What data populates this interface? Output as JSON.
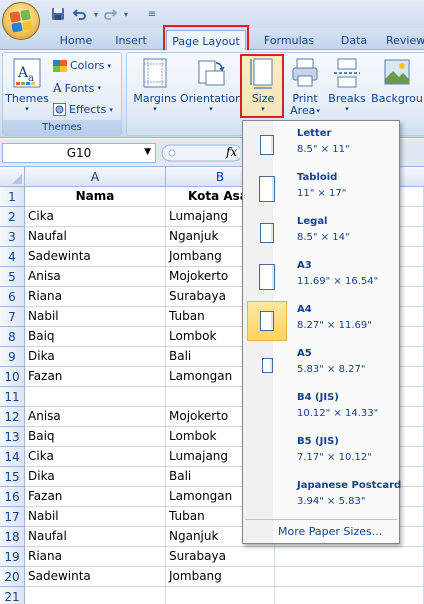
{
  "ribbon_tabs": [
    {
      "label": "Home",
      "active": false
    },
    {
      "label": "Insert",
      "active": false
    },
    {
      "label": "Page Layout",
      "active": true
    },
    {
      "label": "Formulas",
      "active": false
    },
    {
      "label": "Data",
      "active": false
    },
    {
      "label": "Review",
      "active": false
    }
  ],
  "themes_group": {
    "themes_label": "Themes",
    "colors_label": "Colors",
    "fonts_label": "Fonts",
    "effects_label": "Effects",
    "group_label": "Themes"
  },
  "page_setup": {
    "margins_label": "Margins",
    "orientation_label": "Orientation",
    "size_label": "Size",
    "print_area_label_1": "Print",
    "print_area_label_2": "Area",
    "breaks_label": "Breaks",
    "background_label": "Backgrou"
  },
  "formula_bar": {
    "name_box": "G10",
    "fx_symbol": "fx"
  },
  "columns": [
    "A",
    "B"
  ],
  "rows": [
    {
      "n": "1",
      "a": "Nama",
      "b": "Kota Asal",
      "header": true
    },
    {
      "n": "2",
      "a": "Cika",
      "b": "Lumajang"
    },
    {
      "n": "3",
      "a": "Naufal",
      "b": "Nganjuk"
    },
    {
      "n": "4",
      "a": "Sadewinta",
      "b": "Jombang"
    },
    {
      "n": "5",
      "a": "Anisa",
      "b": "Mojokerto"
    },
    {
      "n": "6",
      "a": "Riana",
      "b": "Surabaya"
    },
    {
      "n": "7",
      "a": "Nabil",
      "b": "Tuban"
    },
    {
      "n": "8",
      "a": "Baiq",
      "b": "Lombok"
    },
    {
      "n": "9",
      "a": "Dika",
      "b": "Bali"
    },
    {
      "n": "10",
      "a": "Fazan",
      "b": "Lamongan"
    },
    {
      "n": "11",
      "a": "",
      "b": ""
    },
    {
      "n": "12",
      "a": "Anisa",
      "b": "Mojokerto"
    },
    {
      "n": "13",
      "a": "Baiq",
      "b": "Lombok"
    },
    {
      "n": "14",
      "a": "Cika",
      "b": "Lumajang"
    },
    {
      "n": "15",
      "a": "Dika",
      "b": "Bali"
    },
    {
      "n": "16",
      "a": "Fazan",
      "b": "Lamongan"
    },
    {
      "n": "17",
      "a": "Nabil",
      "b": "Tuban"
    },
    {
      "n": "18",
      "a": "Naufal",
      "b": "Nganjuk"
    },
    {
      "n": "19",
      "a": "Riana",
      "b": "Surabaya"
    },
    {
      "n": "20",
      "a": "Sadewinta",
      "b": "Jombang"
    },
    {
      "n": "21",
      "a": "",
      "b": ""
    }
  ],
  "size_menu": {
    "items": [
      {
        "name": "Letter",
        "dims": "8.5\" × 11\"",
        "selected": false,
        "shape": "portrait"
      },
      {
        "name": "Tabloid",
        "dims": "11\" × 17\"",
        "selected": false,
        "shape": "tall"
      },
      {
        "name": "Legal",
        "dims": "8.5\" × 14\"",
        "selected": false,
        "shape": "portrait"
      },
      {
        "name": "A3",
        "dims": "11.69\" × 16.54\"",
        "selected": false,
        "shape": "tall"
      },
      {
        "name": "A4",
        "dims": "8.27\" × 11.69\"",
        "selected": true,
        "shape": "portrait"
      },
      {
        "name": "A5",
        "dims": "5.83\" × 8.27\"",
        "selected": false,
        "shape": "small"
      },
      {
        "name": "B4 (JIS)",
        "dims": "10.12\" × 14.33\"",
        "selected": false,
        "shape": "none"
      },
      {
        "name": "B5 (JIS)",
        "dims": "7.17\" × 10.12\"",
        "selected": false,
        "shape": "none"
      },
      {
        "name": "Japanese Postcard",
        "dims": "3.94\" × 5.83\"",
        "selected": false,
        "shape": "none"
      }
    ],
    "more_label": "More Paper Sizes..."
  },
  "colors": {
    "accent_red": "#e01d24",
    "selected_gold": "#ffd35e",
    "ribbon_text": "#15428b"
  }
}
